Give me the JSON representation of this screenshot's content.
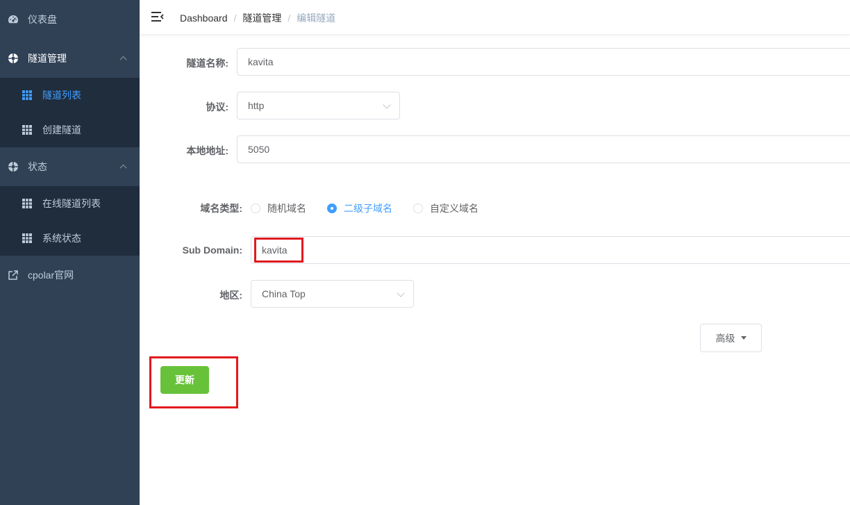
{
  "sidebar": {
    "items": [
      {
        "label": "仪表盘",
        "icon": "dashboard-icon"
      },
      {
        "label": "隧道管理",
        "icon": "gear-icon"
      },
      {
        "label": "隧道列表",
        "icon": "grid-icon"
      },
      {
        "label": "创建隧道",
        "icon": "grid-icon"
      },
      {
        "label": "状态",
        "icon": "gear-icon"
      },
      {
        "label": "在线隧道列表",
        "icon": "grid-icon"
      },
      {
        "label": "系统状态",
        "icon": "grid-icon"
      },
      {
        "label": "cpolar官网",
        "icon": "external-link-icon"
      }
    ],
    "active_color": "#409eff",
    "bg_color": "#304156"
  },
  "header": {
    "breadcrumb": [
      "Dashboard",
      "隧道管理",
      "编辑隧道"
    ],
    "separator": "/"
  },
  "form": {
    "tunnel_name_label": "隧道名称:",
    "tunnel_name_value": "kavita",
    "protocol_label": "协议:",
    "protocol_value": "http",
    "local_addr_label": "本地地址:",
    "local_addr_value": "5050",
    "domain_type_label": "域名类型:",
    "domain_type_options": [
      "随机域名",
      "二级子域名",
      "自定义域名"
    ],
    "domain_type_selected": "二级子域名",
    "subdomain_label": "Sub Domain:",
    "subdomain_value": "kavita",
    "region_label": "地区:",
    "region_value": "China Top",
    "advanced_label": "高级",
    "update_label": "更新"
  },
  "colors": {
    "update_button": "#67c23a",
    "highlight_box": "#e0191e"
  }
}
